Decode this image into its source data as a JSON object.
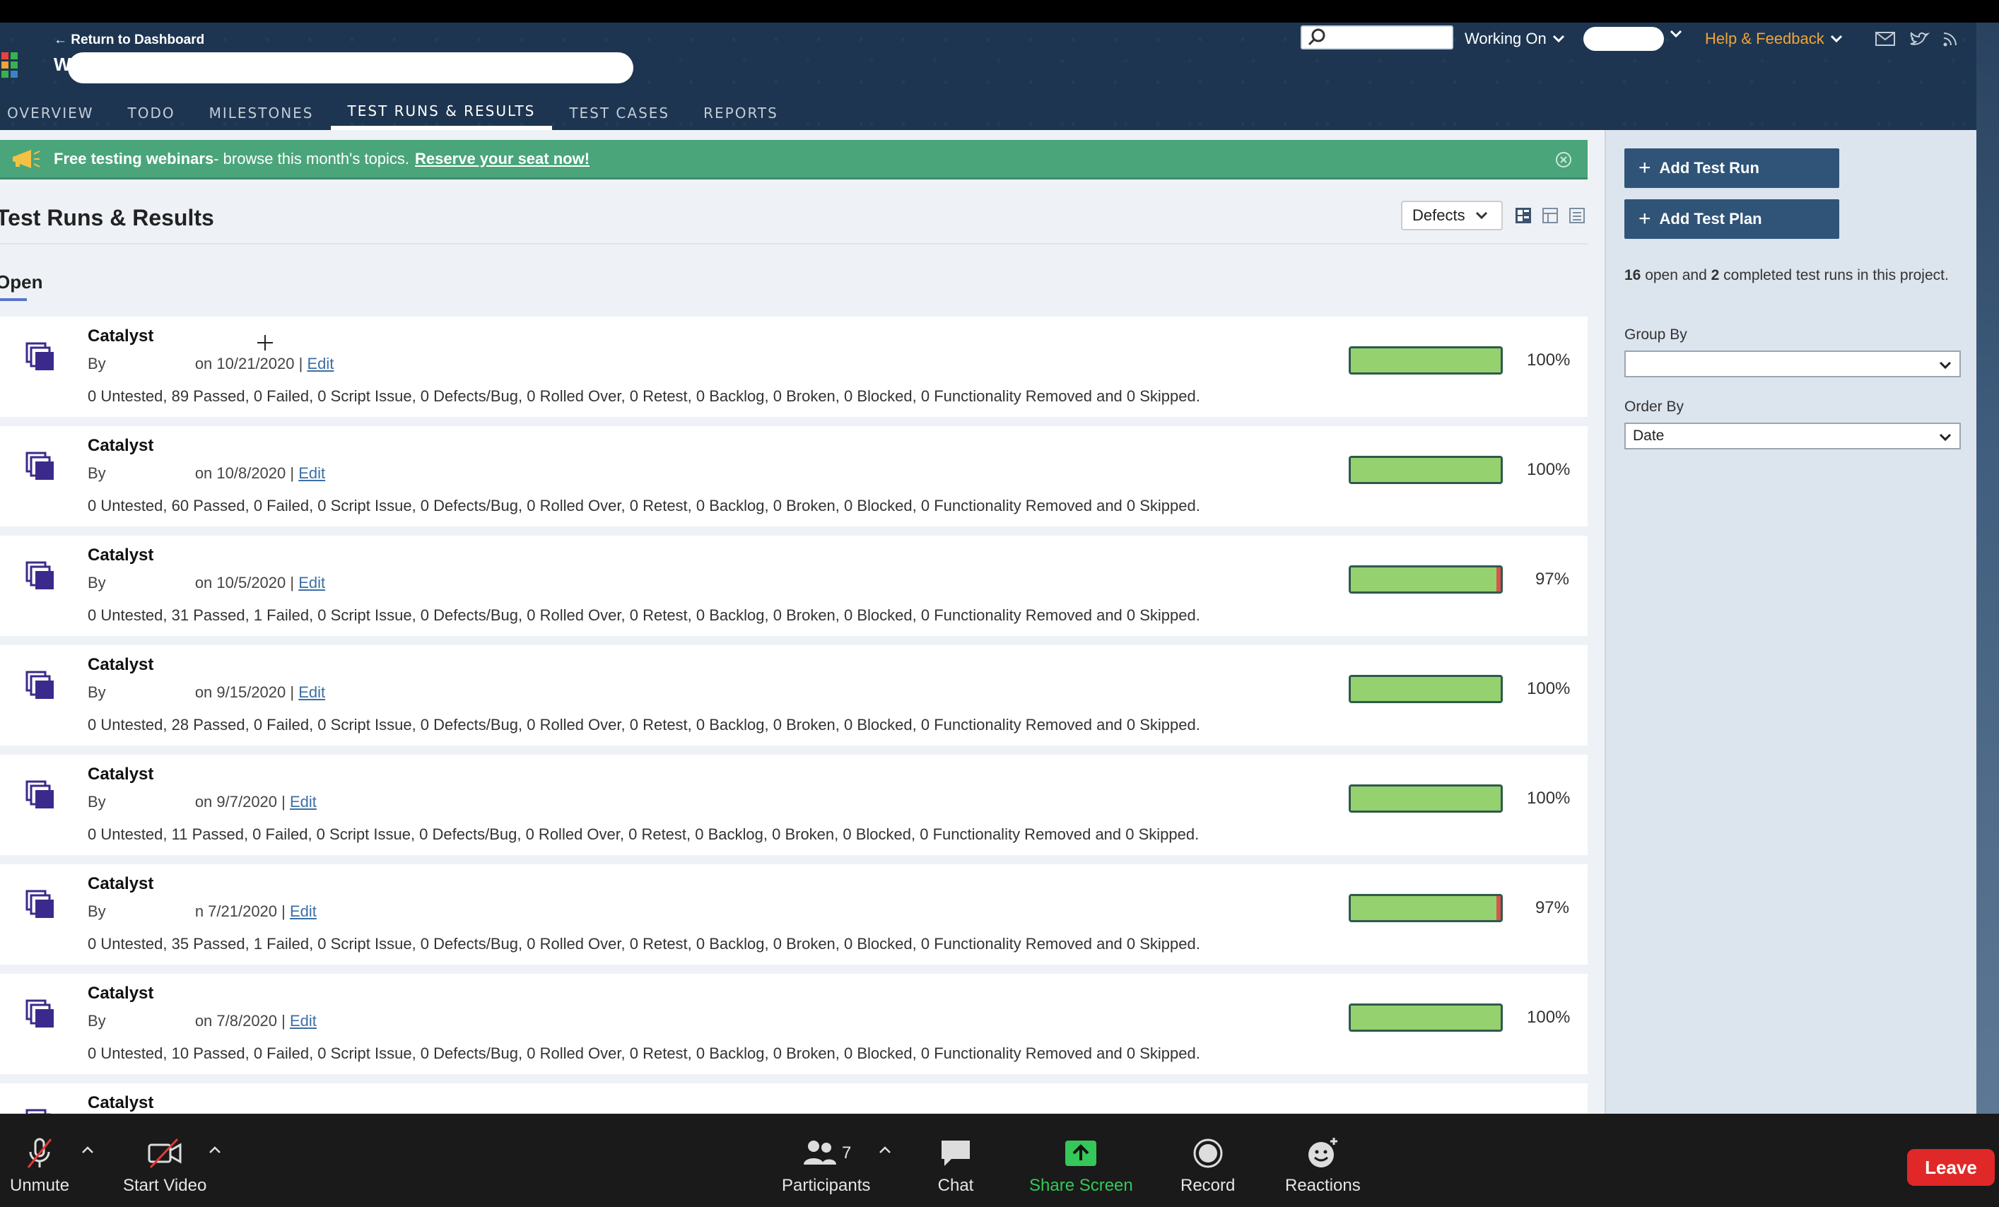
{
  "header": {
    "return_link": "← Return to Dashboard",
    "project_name": "W",
    "working_on": "Working On",
    "help_feedback": "Help & Feedback",
    "search": {
      "value": "",
      "placeholder": ""
    }
  },
  "tabs": [
    {
      "label": "OVERVIEW",
      "active": false
    },
    {
      "label": "TODO",
      "active": false
    },
    {
      "label": "MILESTONES",
      "active": false
    },
    {
      "label": "TEST RUNS & RESULTS",
      "active": true
    },
    {
      "label": "TEST CASES",
      "active": false
    },
    {
      "label": "REPORTS",
      "active": false
    }
  ],
  "banner": {
    "strong": "Free testing webinars",
    "text": " - browse this month's topics.",
    "link": "Reserve your seat now!"
  },
  "page": {
    "title": "Test Runs & Results",
    "view_select": "Defects",
    "section": "Open"
  },
  "runs": [
    {
      "title": "Catalyst",
      "by": "By",
      "date": "on 10/21/2020",
      "edit": "Edit",
      "summary": "0 Untested, 89 Passed, 0 Failed, 0 Script Issue, 0 Defects/Bug, 0 Rolled Over, 0 Retest, 0 Backlog, 0 Broken, 0 Blocked, 0 Functionality Removed and 0 Skipped.",
      "percent": "100%",
      "pass_fraction": 1.0,
      "fail_fraction": 0.0
    },
    {
      "title": "Catalyst",
      "by": "By",
      "date": "on 10/8/2020",
      "edit": "Edit",
      "summary": "0 Untested, 60 Passed, 0 Failed, 0 Script Issue, 0 Defects/Bug, 0 Rolled Over, 0 Retest, 0 Backlog, 0 Broken, 0 Blocked, 0 Functionality Removed and 0 Skipped.",
      "percent": "100%",
      "pass_fraction": 1.0,
      "fail_fraction": 0.0
    },
    {
      "title": "Catalyst",
      "by": "By",
      "date": "on 10/5/2020",
      "edit": "Edit",
      "summary": "0 Untested, 31 Passed, 1 Failed, 0 Script Issue, 0 Defects/Bug, 0 Rolled Over, 0 Retest, 0 Backlog, 0 Broken, 0 Blocked, 0 Functionality Removed and 0 Skipped.",
      "percent": "97%",
      "pass_fraction": 0.97,
      "fail_fraction": 0.03
    },
    {
      "title": "Catalyst",
      "by": "By",
      "date": "on 9/15/2020",
      "edit": "Edit",
      "summary": "0 Untested, 28 Passed, 0 Failed, 0 Script Issue, 0 Defects/Bug, 0 Rolled Over, 0 Retest, 0 Backlog, 0 Broken, 0 Blocked, 0 Functionality Removed and 0 Skipped.",
      "percent": "100%",
      "pass_fraction": 1.0,
      "fail_fraction": 0.0
    },
    {
      "title": "Catalyst",
      "by": "By",
      "date": "on 9/7/2020",
      "edit": "Edit",
      "summary": "0 Untested, 11 Passed, 0 Failed, 0 Script Issue, 0 Defects/Bug, 0 Rolled Over, 0 Retest, 0 Backlog, 0 Broken, 0 Blocked, 0 Functionality Removed and 0 Skipped.",
      "percent": "100%",
      "pass_fraction": 1.0,
      "fail_fraction": 0.0
    },
    {
      "title": "Catalyst",
      "by": "By",
      "date": "n 7/21/2020",
      "edit": "Edit",
      "summary": "0 Untested, 35 Passed, 1 Failed, 0 Script Issue, 0 Defects/Bug, 0 Rolled Over, 0 Retest, 0 Backlog, 0 Broken, 0 Blocked, 0 Functionality Removed and 0 Skipped.",
      "percent": "97%",
      "pass_fraction": 0.97,
      "fail_fraction": 0.03
    },
    {
      "title": "Catalyst",
      "by": "By",
      "date": "on 7/8/2020",
      "edit": "Edit",
      "summary": "0 Untested, 10 Passed, 0 Failed, 0 Script Issue, 0 Defects/Bug, 0 Rolled Over, 0 Retest, 0 Backlog, 0 Broken, 0 Blocked, 0 Functionality Removed and 0 Skipped.",
      "percent": "100%",
      "pass_fraction": 1.0,
      "fail_fraction": 0.0
    },
    {
      "title": "Catalyst",
      "by": "",
      "date": "",
      "edit": "",
      "summary": "",
      "percent": "",
      "pass_fraction": 0.0,
      "fail_fraction": 0.0
    }
  ],
  "sidebar": {
    "add_test_run": "Add Test Run",
    "add_test_plan": "Add Test Plan",
    "stats": {
      "open_count": "16",
      "open_text": " open and ",
      "completed_count": "2",
      "completed_text": " completed test runs in this project."
    },
    "group_by_label": "Group By",
    "group_by_value": "",
    "order_by_label": "Order By",
    "order_by_value": "Date"
  },
  "zoom": {
    "unmute": "Unmute",
    "start_video": "Start Video",
    "participants": "Participants",
    "participants_count": "7",
    "chat": "Chat",
    "share_screen": "Share Screen",
    "record": "Record",
    "reactions": "Reactions",
    "leave": "Leave"
  },
  "colors": {
    "header_bg": "#1d3550",
    "banner_bg": "#4aa57a",
    "pass": "#96d16f",
    "fail": "#d9534f",
    "sidebar_button": "#2f5478",
    "help_accent": "#f0a43a",
    "share_screen": "#35c75a",
    "leave": "#e02828",
    "run_icon": "#3b2a8c"
  }
}
